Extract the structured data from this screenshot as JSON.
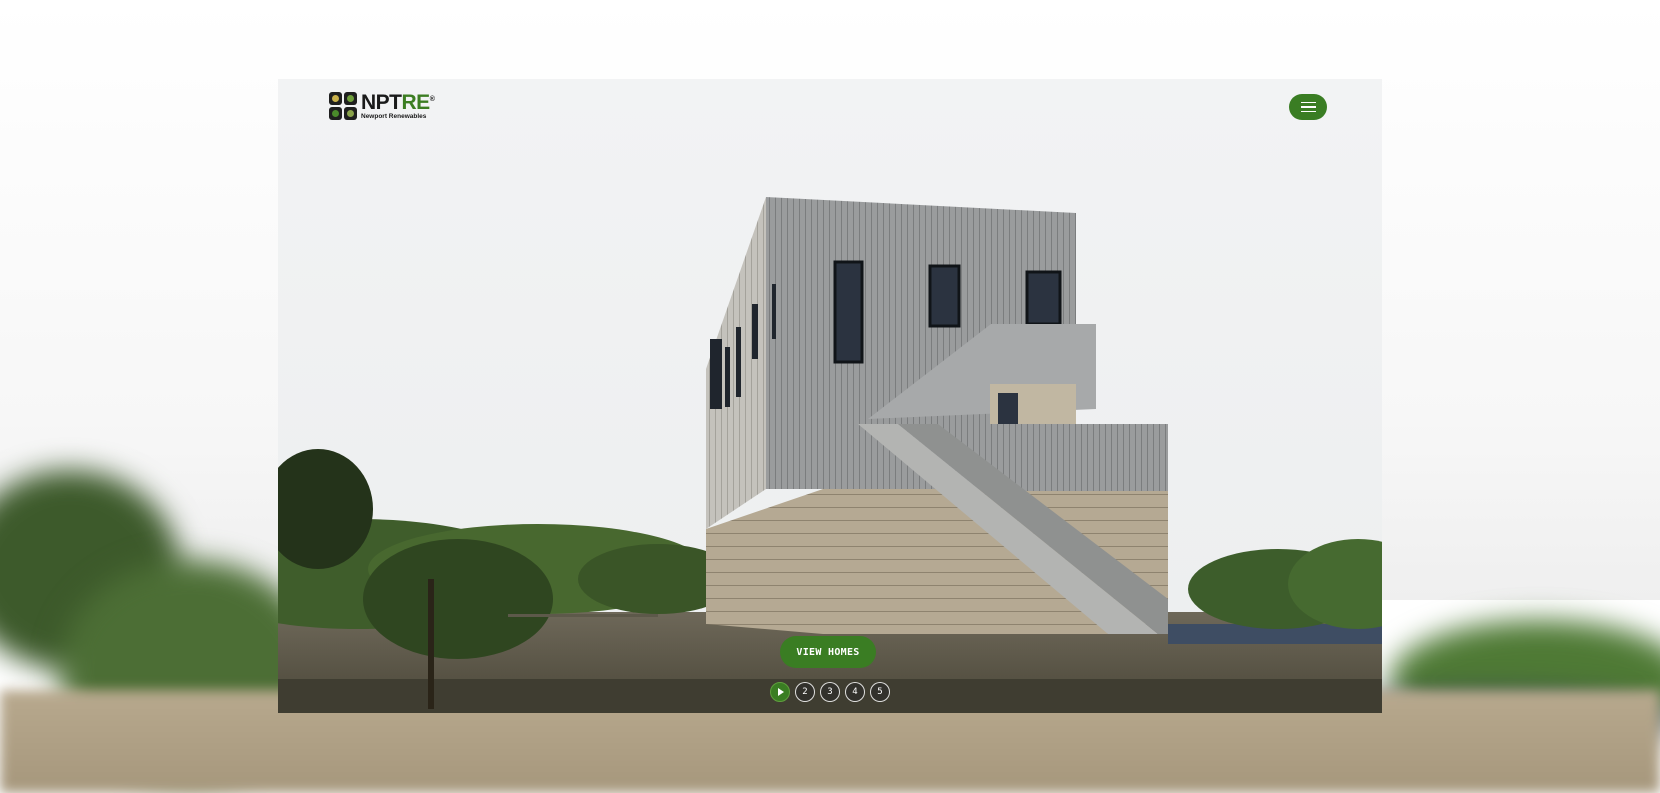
{
  "brand": {
    "name_main": "NPT",
    "name_accent": "RE",
    "registered": "®",
    "tagline": "Newport Renewables",
    "accent_color": "#3a7d23"
  },
  "header": {
    "menu_icon": "hamburger-icon"
  },
  "hero": {
    "cta_label": "VIEW HOMES",
    "slides": [
      {
        "label": "",
        "icon": "play-icon",
        "active": true
      },
      {
        "label": "2",
        "active": false
      },
      {
        "label": "3",
        "active": false
      },
      {
        "label": "4",
        "active": false
      },
      {
        "label": "5",
        "active": false
      }
    ]
  }
}
